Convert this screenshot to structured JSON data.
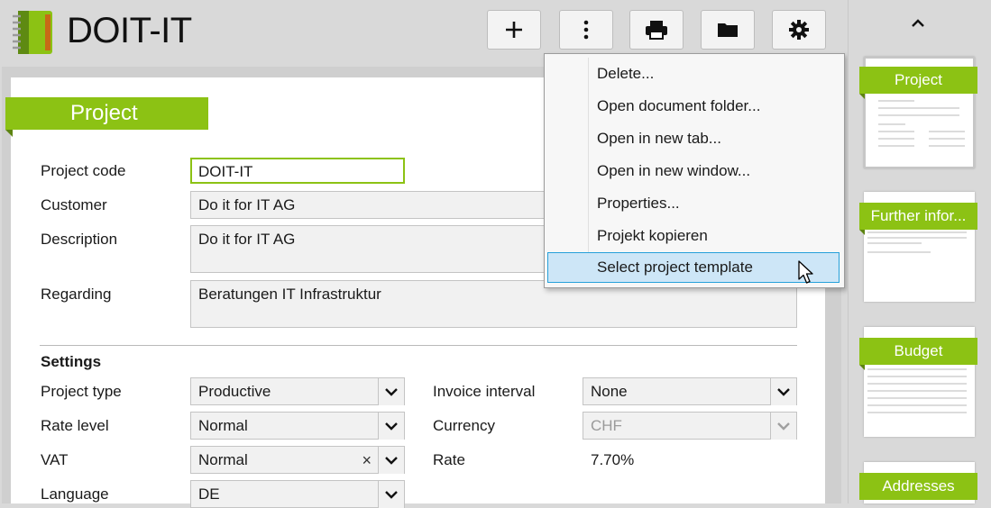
{
  "app": {
    "title": "DOIT-IT",
    "logo_icon": "notebook-icon"
  },
  "toolbar": {
    "buttons": [
      {
        "name": "add-button",
        "icon": "plus-icon"
      },
      {
        "name": "more-button",
        "icon": "vertical-dots-icon"
      },
      {
        "name": "print-button",
        "icon": "printer-icon"
      },
      {
        "name": "folder-button",
        "icon": "folder-icon"
      },
      {
        "name": "settings-button",
        "icon": "gear-icon"
      }
    ]
  },
  "form": {
    "section_title": "Project",
    "project_code": {
      "label": "Project code",
      "value": "DOIT-IT"
    },
    "customer": {
      "label": "Customer",
      "value": "Do it for IT AG"
    },
    "description": {
      "label": "Description",
      "value": "Do it for IT AG"
    },
    "regarding": {
      "label": "Regarding",
      "value": "Beratungen IT Infrastruktur"
    },
    "settings_title": "Settings",
    "project_type": {
      "label": "Project type",
      "value": "Productive"
    },
    "rate_level": {
      "label": "Rate level",
      "value": "Normal"
    },
    "vat": {
      "label": "VAT",
      "value": "Normal",
      "clear_glyph": "×"
    },
    "language": {
      "label": "Language",
      "value": "DE"
    },
    "invoice_interval": {
      "label": "Invoice interval",
      "value": "None"
    },
    "currency": {
      "label": "Currency",
      "value": "CHF"
    },
    "rate": {
      "label": "Rate",
      "value": "7.70%"
    }
  },
  "context_menu": {
    "items": [
      "Delete...",
      "Open document folder...",
      "Open in new tab...",
      "Open in new window...",
      "Properties...",
      "Projekt kopieren",
      "Select project template"
    ],
    "highlighted_index": 6
  },
  "right_panel": {
    "thumbnails": [
      "Project",
      "Further infor...",
      "Budget",
      "Addresses"
    ]
  },
  "colors": {
    "accent": "#8cc214",
    "accent_dark": "#5d8410",
    "highlight": "#cde6f7",
    "highlight_border": "#26a0da"
  }
}
